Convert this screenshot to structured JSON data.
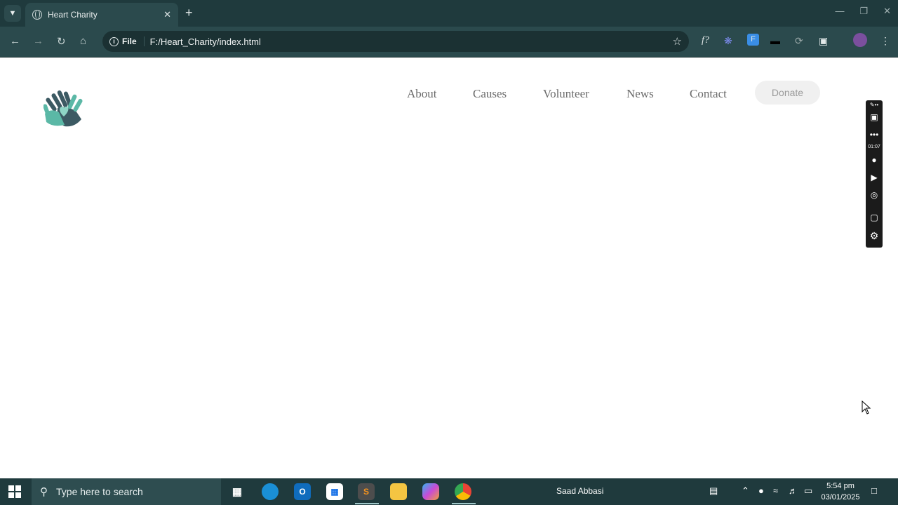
{
  "browser": {
    "tab_title": "Heart Charity",
    "address_chip": "File",
    "url": "F:/Heart_Charity/index.html"
  },
  "site": {
    "nav": [
      "About",
      "Causes",
      "Volunteer",
      "News",
      "Contact"
    ],
    "donate_label": "Donate"
  },
  "recorder": {
    "timer": "01:07"
  },
  "taskbar": {
    "search_placeholder": "Type here to search",
    "user_name": "Saad Abbasi",
    "time": "5:54 pm",
    "date": "03/01/2025"
  },
  "colors": {
    "chrome": "#1f3a3d",
    "toolbar": "#2b4a4d",
    "logo_teal": "#5bb8a6",
    "logo_dark": "#3c5a63"
  }
}
